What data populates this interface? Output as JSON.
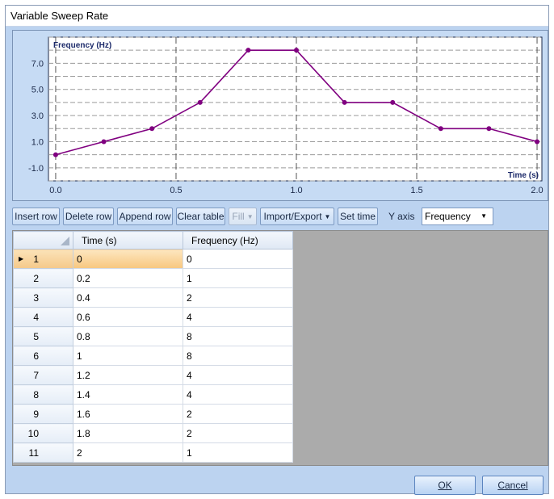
{
  "window": {
    "title": "Variable Sweep Rate"
  },
  "chart_data": {
    "type": "line",
    "ylabel": "Frequency (Hz)",
    "xlabel": "Time (s)",
    "xlim": [
      -0.03,
      2.02
    ],
    "ylim": [
      -2,
      9
    ],
    "x_ticks": [
      0.0,
      0.5,
      1.0,
      1.5,
      2.0
    ],
    "x_tick_labels": [
      "0.0",
      "0.5",
      "1.0",
      "1.5",
      "2.0"
    ],
    "y_ticks": [
      -1,
      1,
      3,
      5,
      7
    ],
    "y_tick_labels": [
      "-1.0",
      "1.0",
      "3.0",
      "5.0",
      "7.0"
    ],
    "grid": true,
    "line_color": "#800080",
    "series": [
      {
        "x": [
          0,
          0.2,
          0.4,
          0.6,
          0.8,
          1.0,
          1.2,
          1.4,
          1.6,
          1.8,
          2.0
        ],
        "values": [
          0,
          1,
          2,
          4,
          8,
          8,
          4,
          4,
          2,
          2,
          1
        ]
      }
    ]
  },
  "toolbar": {
    "insert_row": "Insert row",
    "delete_row": "Delete row",
    "append_row": "Append row",
    "clear_table": "Clear table",
    "fill": "Fill",
    "import_export": "Import/Export",
    "set_time": "Set time",
    "y_axis_label": "Y axis",
    "y_axis_value": "Frequency"
  },
  "table": {
    "headers": [
      "Time (s)",
      "Frequency (Hz)"
    ],
    "rows": [
      {
        "n": "1",
        "time": "0",
        "freq": "0"
      },
      {
        "n": "2",
        "time": "0.2",
        "freq": "1"
      },
      {
        "n": "3",
        "time": "0.4",
        "freq": "2"
      },
      {
        "n": "4",
        "time": "0.6",
        "freq": "4"
      },
      {
        "n": "5",
        "time": "0.8",
        "freq": "8"
      },
      {
        "n": "6",
        "time": "1",
        "freq": "8"
      },
      {
        "n": "7",
        "time": "1.2",
        "freq": "4"
      },
      {
        "n": "8",
        "time": "1.4",
        "freq": "4"
      },
      {
        "n": "9",
        "time": "1.6",
        "freq": "2"
      },
      {
        "n": "10",
        "time": "1.8",
        "freq": "2"
      },
      {
        "n": "11",
        "time": "2",
        "freq": "1"
      }
    ]
  },
  "buttons": {
    "ok": "OK",
    "cancel": "Cancel"
  }
}
